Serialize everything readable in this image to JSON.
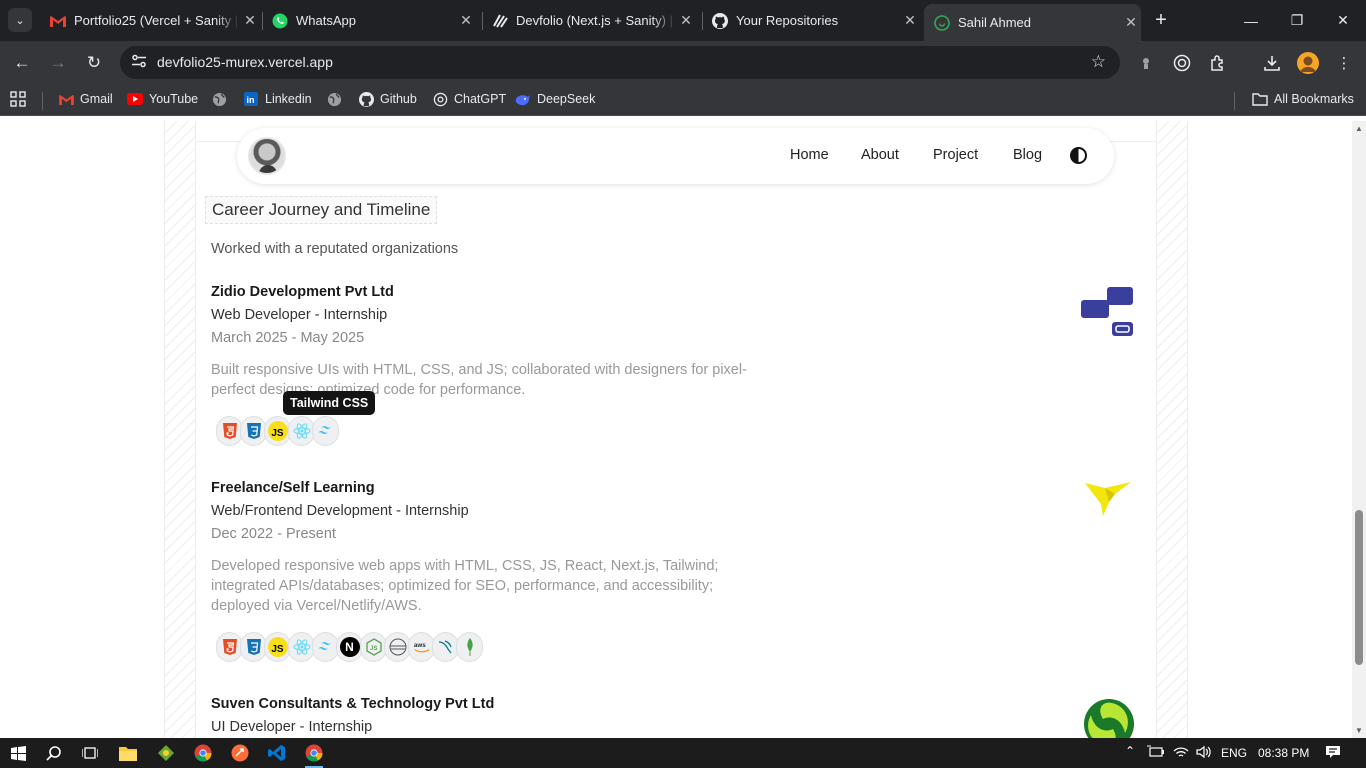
{
  "browser": {
    "tabs": [
      {
        "title": "Portfolio25 (Vercel + Sanity |",
        "icon": "gmail-icon"
      },
      {
        "title": "WhatsApp",
        "icon": "whatsapp-icon"
      },
      {
        "title": "Devfolio (Next.js + Sanity) | s",
        "icon": "devfolio-icon"
      },
      {
        "title": "Your Repositories",
        "icon": "github-icon"
      },
      {
        "title": "Sahil Ahmed",
        "icon": "site-icon",
        "active": true
      }
    ],
    "url": "devfolio25-murex.vercel.app",
    "bookmarks": [
      {
        "label": "Gmail"
      },
      {
        "label": "YouTube"
      },
      {
        "label": ""
      },
      {
        "label": "Linkedin"
      },
      {
        "label": ""
      },
      {
        "label": "Github"
      },
      {
        "label": "ChatGPT"
      },
      {
        "label": "DeepSeek"
      }
    ],
    "all_bookmarks": "All Bookmarks"
  },
  "nav": {
    "links": [
      "Home",
      "About",
      "Project",
      "Blog"
    ]
  },
  "section": {
    "title": "Career Journey and Timeline",
    "subtitle": "Worked with a reputated organizations"
  },
  "experiences": [
    {
      "company": "Zidio Development Pvt Ltd",
      "role": "Web Developer - Internship",
      "date": "March 2025 - May 2025",
      "description": "Built responsive UIs with HTML, CSS, and JS; collaborated with designers for pixel-perfect designs; optimized code for performance.",
      "tech": [
        "html5",
        "css3",
        "javascript",
        "react",
        "tailwind"
      ]
    },
    {
      "company": "Freelance/Self Learning",
      "role": "Web/Frontend Development - Internship",
      "date": "Dec 2022 - Present",
      "description": "Developed responsive web apps with HTML, CSS, JS, React, Next.js, Tailwind; integrated APIs/databases; optimized for SEO, performance, and accessibility; deployed via Vercel/Netlify/AWS.",
      "tech": [
        "html5",
        "css3",
        "javascript",
        "react",
        "tailwind",
        "nextjs",
        "nodejs",
        "express",
        "aws",
        "mysql",
        "mongodb"
      ]
    },
    {
      "company": "Suven Consultants & Technology Pvt Ltd",
      "role": "UI Developer - Internship"
    }
  ],
  "tooltip": "Tailwind CSS",
  "taskbar": {
    "lang": "ENG",
    "time": "08:38 PM"
  },
  "colors": {
    "chrome_dark": "#202124",
    "chrome_toolbar": "#35363a",
    "zidio_blue": "#3a3f9e",
    "freelance_yellow": "#f2e60c",
    "suven_green": "#1a7a2a"
  }
}
